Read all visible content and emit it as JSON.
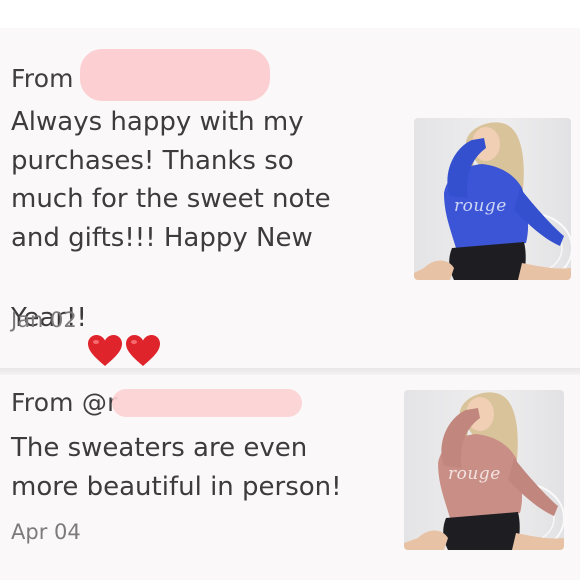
{
  "reviews": [
    {
      "from_label": "From",
      "text": "Always happy with my\npurchases! Thanks so\nmuch for the sweet note\nand gifts!!! Happy New\nYear!!",
      "emoji": "❤️❤️",
      "date": "Jan 02",
      "product_image": {
        "icon": "blue-sweater-photo",
        "sweater_color": "#3b55d6",
        "watermark": "rouge"
      }
    },
    {
      "from_label": "From @r",
      "text": "The sweaters are even\nmore beautiful in person!",
      "date": "Apr 04",
      "product_image": {
        "icon": "pink-sweater-photo",
        "sweater_color": "#c98f86",
        "watermark": "rouge"
      }
    }
  ],
  "colors": {
    "redaction": "#fcd0d2",
    "card_bg": "#fbf8fa",
    "heart": "#e0242b"
  }
}
